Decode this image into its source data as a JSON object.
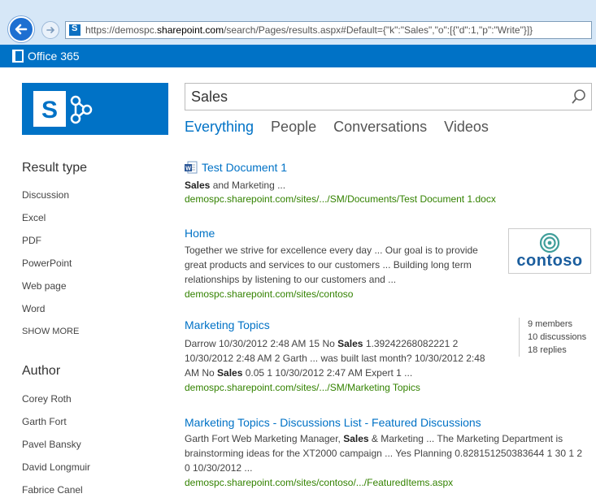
{
  "browser": {
    "url_prefix": "https://demospc.",
    "url_domain": "sharepoint.com",
    "url_suffix": "/search/Pages/results.aspx#Default={\"k\":\"Sales\",\"o\":[{\"d\":1,\"p\":\"Write\"}]}"
  },
  "suitebar": {
    "brand": "Office 365"
  },
  "search": {
    "query": "Sales"
  },
  "verticals": [
    "Everything",
    "People",
    "Conversations",
    "Videos"
  ],
  "refiners": {
    "result_type": {
      "title": "Result type",
      "items": [
        "Discussion",
        "Excel",
        "PDF",
        "PowerPoint",
        "Web page",
        "Word"
      ],
      "show_more": "SHOW MORE"
    },
    "author": {
      "title": "Author",
      "items": [
        "Corey Roth",
        "Garth Fort",
        "Pavel Bansky",
        "David Longmuir",
        "Fabrice Canel"
      ]
    }
  },
  "results": [
    {
      "title": "Test Document 1",
      "snippet": [
        [
          "Sales",
          true
        ],
        [
          " and Marketing ...",
          false
        ]
      ],
      "url": "demospc.sharepoint.com/sites/.../SM/Documents/Test Document 1.docx"
    },
    {
      "title": "Home",
      "snippet": [
        [
          "Together we strive for excellence every day ... Our goal is to provide great products and services to our customers ... Building long term relationships by listening to our customers and ...",
          false
        ]
      ],
      "url": "demospc.sharepoint.com/sites/contoso",
      "thumbnail_text": "contoso"
    },
    {
      "title": "Marketing Topics",
      "snippet": [
        [
          "Darrow 10/30/2012 2:48 AM 15 No ",
          false
        ],
        [
          "Sales",
          true
        ],
        [
          " 1.39242268082221 2 10/30/2012 2:48 AM 2 Garth ... was built last month? 10/30/2012 2:48 AM No ",
          false
        ],
        [
          "Sales",
          true
        ],
        [
          " 0.05 1 10/30/2012 2:47 AM Expert 1 ...",
          false
        ]
      ],
      "url": "demospc.sharepoint.com/sites/.../SM/Marketing Topics",
      "stats": [
        "9 members",
        "10 discussions",
        "18 replies"
      ]
    },
    {
      "title": "Marketing Topics - Discussions List - Featured Discussions",
      "snippet": [
        [
          "Garth Fort Web Marketing Manager, ",
          false
        ],
        [
          "Sales",
          true
        ],
        [
          " & Marketing ... The Marketing Department is brainstorming ideas for the XT2000 campaign ... Yes Planning 0.828151250383644 1 30 1 2 0 10/30/2012 ...",
          false
        ]
      ],
      "url": "demospc.sharepoint.com/sites/contoso/.../FeaturedItems.aspx"
    }
  ],
  "colors": {
    "accent": "#0072c6",
    "url_green": "#338200",
    "chrome": "#d6e7f7"
  }
}
